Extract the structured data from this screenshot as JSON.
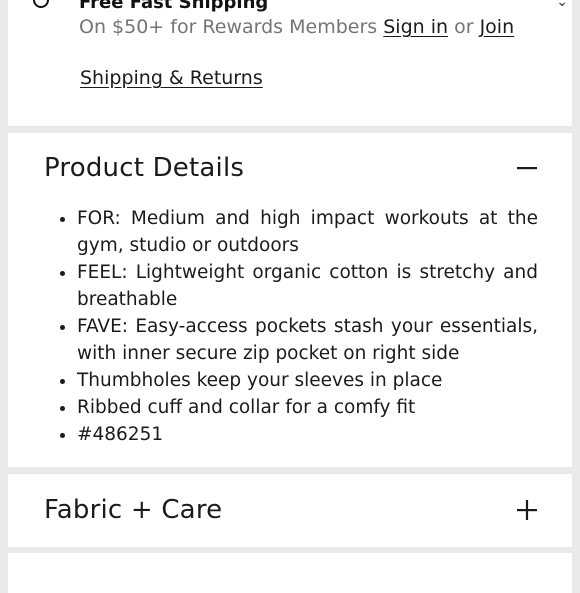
{
  "shipping": {
    "title": "Free Fast Shipping",
    "offer_prefix": "On $50+ for Rewards Members",
    "sign_in_label": "Sign in",
    "or_text": "or",
    "join_label": "Join",
    "returns_label": "Shipping & Returns"
  },
  "product_details": {
    "title": "Product Details",
    "toggle_state": "expanded",
    "items": [
      "FOR: Medium and high impact workouts at the gym, studio or outdoors",
      "FEEL: Lightweight organic cotton is stretchy and breathable",
      "FAVE: Easy-access pockets stash your essentials, with inner secure zip pocket on right side",
      "Thumbholes keep your sleeves in place",
      "Ribbed cuff and collar for a comfy fit",
      "#486251"
    ]
  },
  "fabric_care": {
    "title": "Fabric + Care",
    "toggle_state": "collapsed"
  },
  "icons": {
    "collapse": "minus-icon",
    "expand": "plus-icon",
    "shipping": "shipping-info-icon",
    "chevron": "chevron-down-icon"
  }
}
